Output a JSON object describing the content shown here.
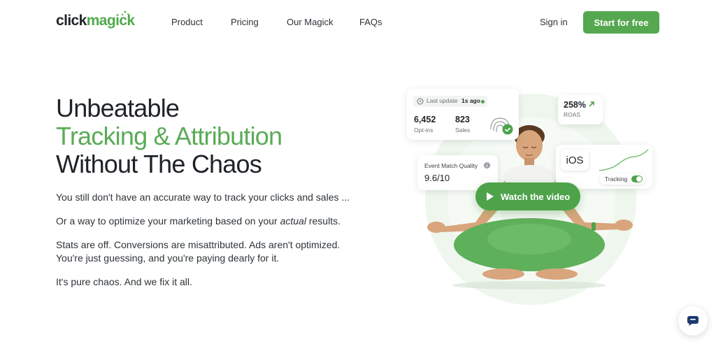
{
  "nav": {
    "logo_dark": "click",
    "logo_green": "magick",
    "links": [
      "Product",
      "Pricing",
      "Our Magick",
      "FAQs"
    ],
    "signin": "Sign in",
    "cta": "Start for free"
  },
  "hero": {
    "line1": "Unbeatable",
    "line2": "Tracking & Attribution",
    "line3": "Without The Chaos",
    "p1": "You still don't have an accurate way to track your clicks and sales ...",
    "p2_before": "Or a way to optimize your marketing based on your ",
    "p2_em": "actual",
    "p2_after": " results.",
    "p3a": "Stats are off. Conversions are misattributed. Ads aren't optimized.",
    "p3b": "You're just guessing, and you're paying dearly for it.",
    "p4": "It's pure chaos. And we fix it all."
  },
  "illustration": {
    "update_label": "Last update",
    "update_time": "1s ago",
    "optins_value": "6,452",
    "optins_label": "Opt-ins",
    "sales_value": "823",
    "sales_label": "Sales",
    "roas_value": "258%",
    "roas_label": "ROAS",
    "emq_label": "Event Match Quality",
    "emq_value": "9.6/10",
    "ios_label": "iOS",
    "tracking_label": "Tracking",
    "watch_label": "Watch the video"
  },
  "colors": {
    "accent": "#55a84f",
    "text": "#1f2328",
    "bg_circle": "#eef6ee"
  }
}
